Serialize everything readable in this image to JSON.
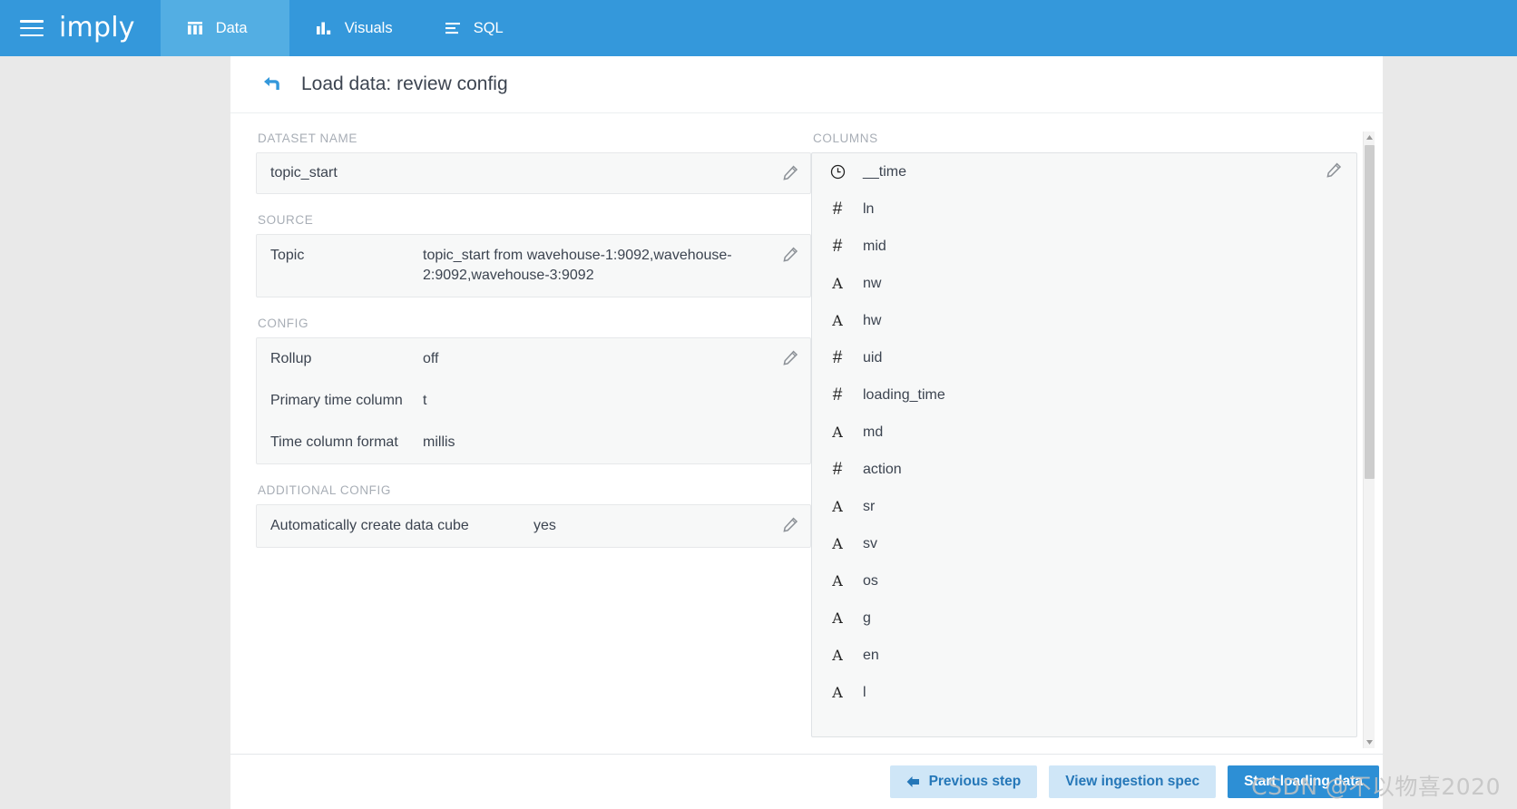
{
  "nav": {
    "brand": "imply",
    "menu_icon": "hamburger-icon",
    "tabs": [
      {
        "label": "Data",
        "icon": "table-columns-icon",
        "active": true
      },
      {
        "label": "Visuals",
        "icon": "bar-chart-icon",
        "active": false
      },
      {
        "label": "SQL",
        "icon": "sql-lines-icon",
        "active": false
      }
    ]
  },
  "header": {
    "back_icon": "back-arrow-icon",
    "title": "Load data: review config"
  },
  "left": {
    "dataset_label": "DATASET NAME",
    "dataset_value": "topic_start",
    "source_label": "SOURCE",
    "source_rows": [
      {
        "key": "Topic",
        "value": "topic_start from wavehouse-1:9092,wavehouse-2:9092,wavehouse-3:9092"
      }
    ],
    "config_label": "CONFIG",
    "config_rows": [
      {
        "key": "Rollup",
        "value": "off"
      },
      {
        "key": "Primary time column",
        "value": "t"
      },
      {
        "key": "Time column format",
        "value": "millis"
      }
    ],
    "additional_label": "ADDITIONAL CONFIG",
    "additional_rows": [
      {
        "key": "Automatically create data cube",
        "value": "yes"
      }
    ]
  },
  "right": {
    "columns_label": "COLUMNS",
    "columns": [
      {
        "name": "__time",
        "type": "time"
      },
      {
        "name": "ln",
        "type": "number"
      },
      {
        "name": "mid",
        "type": "number"
      },
      {
        "name": "nw",
        "type": "string"
      },
      {
        "name": "hw",
        "type": "string"
      },
      {
        "name": "uid",
        "type": "number"
      },
      {
        "name": "loading_time",
        "type": "number"
      },
      {
        "name": "md",
        "type": "string"
      },
      {
        "name": "action",
        "type": "number"
      },
      {
        "name": "sr",
        "type": "string"
      },
      {
        "name": "sv",
        "type": "string"
      },
      {
        "name": "os",
        "type": "string"
      },
      {
        "name": "g",
        "type": "string"
      },
      {
        "name": "en",
        "type": "string"
      },
      {
        "name": "l",
        "type": "string"
      }
    ]
  },
  "footer": {
    "previous_label": "Previous step",
    "view_spec_label": "View ingestion spec",
    "start_label": "Start loading data"
  },
  "watermark": "CSDN @不以物喜2020",
  "colors": {
    "nav_blue": "#3498db",
    "nav_active_blue": "#53aee3",
    "primary_button": "#2d8fd5",
    "light_button": "#cfe6f7",
    "light_button_text": "#2577b8",
    "page_background": "#e9e9e9",
    "panel_fill": "#f7f8f8"
  }
}
